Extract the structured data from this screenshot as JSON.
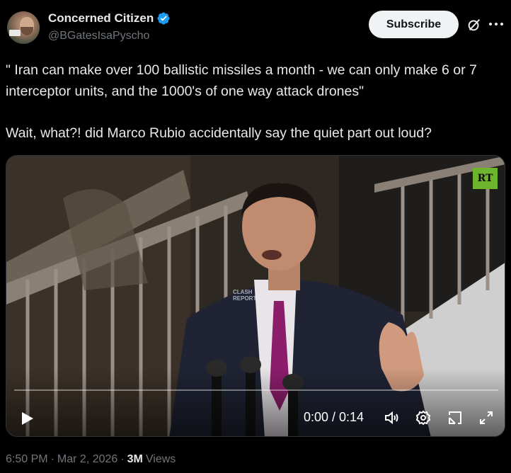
{
  "author": {
    "display_name": "Concerned Citizen",
    "handle": "@BGatesIsaPyscho",
    "verified": true,
    "verified_color": "#1d9bf0"
  },
  "header": {
    "subscribe_label": "Subscribe",
    "grok_icon": "grok-slash-icon",
    "more_icon": "more-dots-icon"
  },
  "post": {
    "text": "\" Iran can make over 100 ballistic missiles a month - we can only make 6 or 7 interceptor units, and the 1000's of one way attack drones\"",
    "text_line2": "Wait, what?!  did Marco Rubio accidentally say the quiet part out loud?"
  },
  "video": {
    "channel_logo": "RT",
    "watermark": "CLASH REPORT",
    "time_display": "0:00 / 0:14",
    "progress": 0,
    "controls": [
      "play-icon",
      "volume-icon",
      "settings-icon",
      "pip-icon",
      "fullscreen-icon"
    ]
  },
  "meta": {
    "time": "6:50 PM",
    "date": "Mar 2, 2026",
    "views_count": "3M",
    "views_label": "Views"
  },
  "colors": {
    "background": "#000000",
    "text": "#e7e9ea",
    "muted": "#71767b",
    "rt_green": "#6cb52d",
    "tie": "#8b1d6b"
  }
}
